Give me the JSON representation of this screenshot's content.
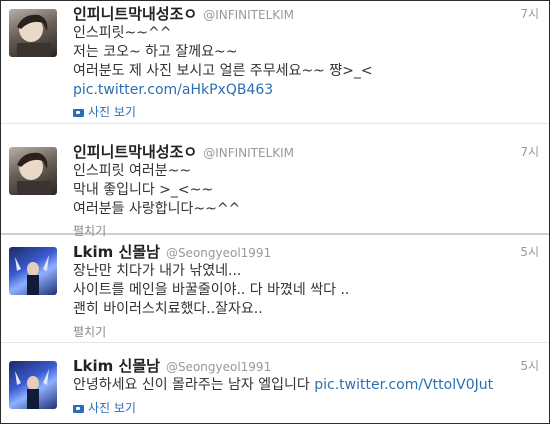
{
  "tweets": [
    {
      "name": "인피니트막내성조ㅇ",
      "handle": "@INFINITELKIM",
      "time": "7시",
      "lines": [
        "인스피릿~~^^",
        "저는 코오~ 하고 잘께요~~",
        "여러분도 제 사진 보시고 얼른 주무세요~~ 쨩>_<"
      ],
      "link": "pic.twitter.com/aHkPxQB463",
      "action": "사진 보기"
    },
    {
      "name": "인피니트막내성조ㅇ",
      "handle": "@INFINITELKIM",
      "time": "7시",
      "lines": [
        "인스피릿 여러분~~",
        "막내 좋입니다 >_<~~",
        "여러분들 사랑합니다~~^^"
      ],
      "action": "펼치기"
    },
    {
      "name": "Lkim 신몰남",
      "handle": "@Seongyeol1991",
      "time": "5시",
      "lines": [
        "장난만 치다가 내가 낚였네...",
        "사이트를 메인을 바꿀줄이야.. 다 바꼈네 싹다 ..",
        "괜히 바이러스치료했다..잘자요.."
      ],
      "action": "펼치기"
    },
    {
      "name": "Lkim 신몰남",
      "handle": "@Seongyeol1991",
      "time": "5시",
      "text": "안녕하세요 신이 몰라주는 남자 엘입니다",
      "link": "pic.twitter.com/VttolV0Jut",
      "action": "사진 보기"
    }
  ]
}
